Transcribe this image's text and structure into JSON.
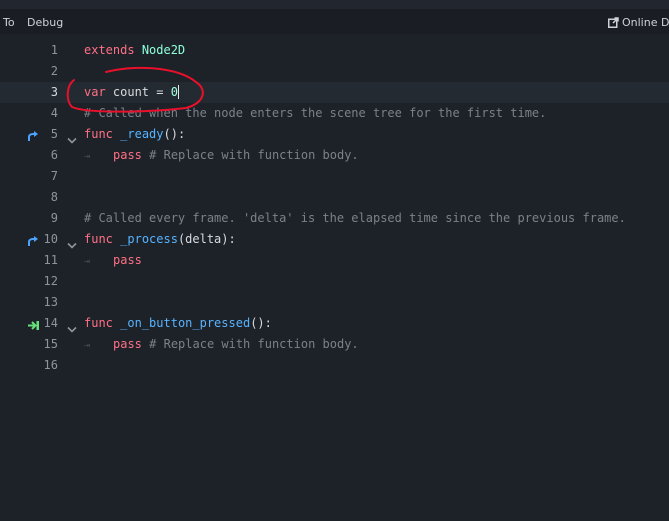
{
  "menu": {
    "to_label": "To",
    "debug_label": "Debug",
    "online_docs_label": "Online Do"
  },
  "editor": {
    "lines": [
      {
        "num": "1",
        "tokens": [
          {
            "t": "extends",
            "c": "kw"
          },
          {
            "t": " "
          },
          {
            "t": "Node2D",
            "c": "type"
          }
        ]
      },
      {
        "num": "2",
        "tokens": []
      },
      {
        "num": "3",
        "tokens": [
          {
            "t": "var",
            "c": "kw"
          },
          {
            "t": " count = "
          },
          {
            "t": "0",
            "c": "num"
          }
        ],
        "current": true,
        "caret": true
      },
      {
        "num": "4",
        "tokens": [
          {
            "t": "# Called when the node enters the scene tree for the first time.",
            "c": "cm"
          }
        ]
      },
      {
        "num": "5",
        "tokens": [
          {
            "t": "func",
            "c": "kw"
          },
          {
            "t": " "
          },
          {
            "t": "_ready",
            "c": "fn"
          },
          {
            "t": "():"
          }
        ],
        "fold": true,
        "icon": "override-icon"
      },
      {
        "num": "6",
        "tokens": [
          {
            "t": "pass",
            "c": "kw"
          },
          {
            "t": " "
          },
          {
            "t": "# Replace with function body.",
            "c": "cm"
          }
        ],
        "indent": 1
      },
      {
        "num": "7",
        "tokens": []
      },
      {
        "num": "8",
        "tokens": []
      },
      {
        "num": "9",
        "tokens": [
          {
            "t": "# Called every frame. 'delta' is the elapsed time since the previous frame.",
            "c": "cm"
          }
        ]
      },
      {
        "num": "10",
        "tokens": [
          {
            "t": "func",
            "c": "kw"
          },
          {
            "t": " "
          },
          {
            "t": "_process",
            "c": "fn"
          },
          {
            "t": "(delta):"
          }
        ],
        "fold": true,
        "icon": "override-icon"
      },
      {
        "num": "11",
        "tokens": [
          {
            "t": "pass",
            "c": "kw"
          }
        ],
        "indent": 1
      },
      {
        "num": "12",
        "tokens": []
      },
      {
        "num": "13",
        "tokens": []
      },
      {
        "num": "14",
        "tokens": [
          {
            "t": "func",
            "c": "kw"
          },
          {
            "t": " "
          },
          {
            "t": "_on_button_pressed",
            "c": "fn"
          },
          {
            "t": "():"
          }
        ],
        "fold": true,
        "icon": "signal-connection-icon"
      },
      {
        "num": "15",
        "tokens": [
          {
            "t": "pass",
            "c": "kw"
          },
          {
            "t": " "
          },
          {
            "t": "# Replace with function body.",
            "c": "cm"
          }
        ],
        "indent": 1
      },
      {
        "num": "16",
        "tokens": []
      }
    ]
  },
  "colors": {
    "keyword": "#ff7085",
    "type": "#8effda",
    "function": "#57b3ff",
    "comment": "#7b8189",
    "annotation": "#e8102a"
  }
}
